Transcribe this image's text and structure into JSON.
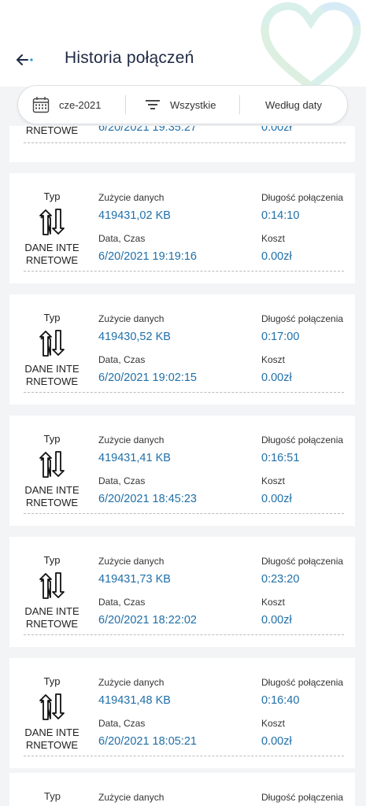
{
  "header": {
    "title": "Historia połączeń",
    "back_icon": "arrow-left-icon"
  },
  "filters": {
    "date_label": "cze-2021",
    "type_label": "Wszystkie",
    "sort_label": "Według daty"
  },
  "labels": {
    "type": "Typ",
    "data_usage": "Zużycie danych",
    "duration": "Długość połączenia",
    "datetime": "Data, Czas",
    "cost": "Koszt"
  },
  "partial_top": {
    "type_value": "RNETOWE",
    "datetime": "6/20/2021 19:35:27",
    "cost": "0.00zł"
  },
  "records": [
    {
      "type": "DANE INTERNETOWE",
      "usage": "419431,02 KB",
      "duration": "0:14:10",
      "datetime": "6/20/2021 19:19:16",
      "cost": "0.00zł"
    },
    {
      "type": "DANE INTERNETOWE",
      "usage": "419430,52 KB",
      "duration": "0:17:00",
      "datetime": "6/20/2021 19:02:15",
      "cost": "0.00zł"
    },
    {
      "type": "DANE INTERNETOWE",
      "usage": "419431,41 KB",
      "duration": "0:16:51",
      "datetime": "6/20/2021 18:45:23",
      "cost": "0.00zł"
    },
    {
      "type": "DANE INTERNETOWE",
      "usage": "419431,73 KB",
      "duration": "0:23:20",
      "datetime": "6/20/2021 18:22:02",
      "cost": "0.00zł"
    },
    {
      "type": "DANE INTERNETOWE",
      "usage": "419431,48 KB",
      "duration": "0:16:40",
      "datetime": "6/20/2021 18:05:21",
      "cost": "0.00zł"
    }
  ],
  "partial_bottom": {
    "type_label": "Typ",
    "usage_label": "Zużycie danych",
    "duration_label": "Długość połączenia"
  },
  "colors": {
    "accent": "#1f6fa8",
    "title": "#1f2a44",
    "background": "#f3f4f6"
  }
}
